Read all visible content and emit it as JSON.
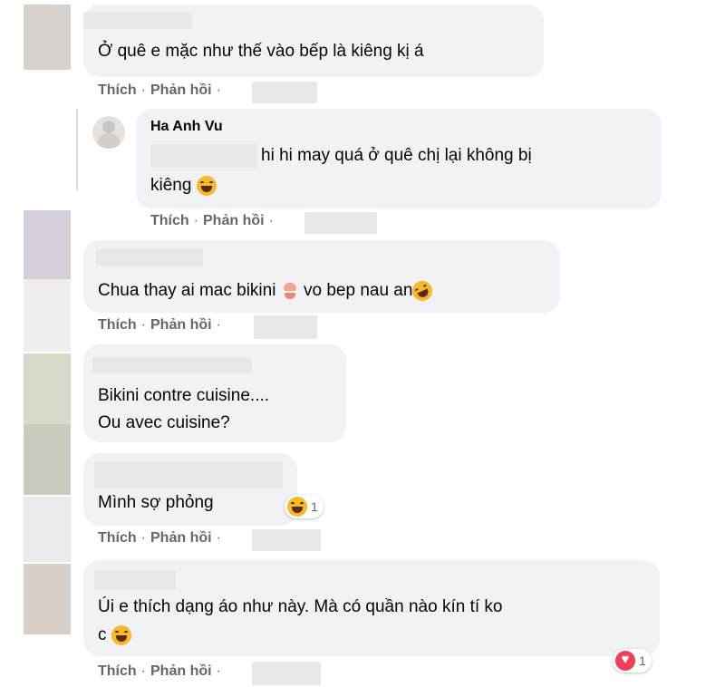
{
  "ui": {
    "action_like": "Thích",
    "action_reply": "Phản hồi",
    "separator": "·"
  },
  "comments": [
    {
      "text": "Ở quê e mặc như thế vào bếp là kiêng kị á"
    },
    {
      "author": "Ha Anh Vu",
      "text_line1": "hi hi may quá ở quê chị lại không bị",
      "text_line2": "kiêng"
    },
    {
      "text": "Chua thay ai mac bikini",
      "text_after": "vo bep nau an"
    },
    {
      "text_line1": "Bikini contre cuisine....",
      "text_line2": "Ou avec cuisine?"
    },
    {
      "text": "Mình sợ phỏng",
      "reaction_count": "1"
    },
    {
      "text_line1": "Úi e thích dạng áo như này. Mà có quần nào kín tí ko",
      "text_line2": "c",
      "reaction_count": "1"
    }
  ],
  "colors": {
    "bubble": "#f0f2f5",
    "meta": "#65676b",
    "haha": "#f7b928",
    "love": "#f33e58"
  },
  "icons": [
    "haha-emoji-icon",
    "rofl-emoji-icon",
    "bikini-emoji-icon",
    "love-reaction-icon",
    "avatar-icon"
  ]
}
